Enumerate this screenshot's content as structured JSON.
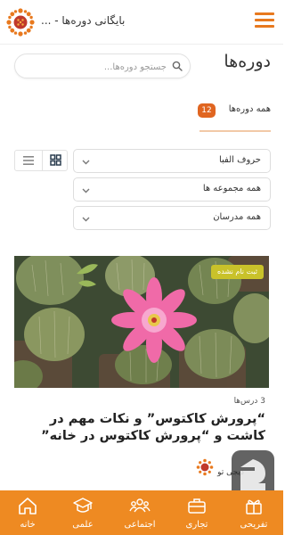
{
  "header": {
    "title": "بایگانی دوره‌ها - ...",
    "logo_icon": "sunflower-logo",
    "menu_icon": "hamburger-icon"
  },
  "search": {
    "placeholder": "جستجو دوره‌ها..."
  },
  "page_title": "دوره‌ها",
  "all_courses": {
    "label": "همه دوره‌ها",
    "count": "12"
  },
  "filters": {
    "sort": "حروف الفبا",
    "collection": "همه مجموعه ها",
    "teachers": "همه مدرسان"
  },
  "view_modes": [
    "grid",
    "list"
  ],
  "course": {
    "status": "ثبت نام نشده",
    "lessons": "3 درس‌ها",
    "title": "“پرورش کاکتوس” و نکات مهم در کاشت و “پرورش کاکتوس در خانه”",
    "teacher": "دیجی تو"
  },
  "bottom_nav": [
    {
      "label": "خانه",
      "icon": "home-icon"
    },
    {
      "label": "علمی",
      "icon": "graduation-cap-icon"
    },
    {
      "label": "اجتماعی",
      "icon": "people-icon"
    },
    {
      "label": "تجاری",
      "icon": "briefcase-icon"
    },
    {
      "label": "تفریحی",
      "icon": "gift-icon"
    }
  ],
  "colors": {
    "accent": "#ee8a22",
    "badge": "#e06520",
    "status_badge": "#c9c22a"
  }
}
